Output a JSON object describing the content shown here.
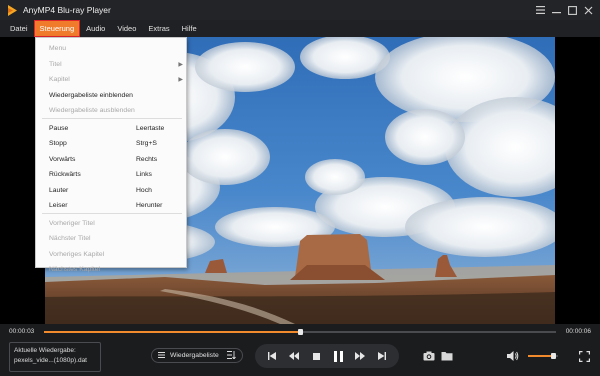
{
  "app": {
    "title": "AnyMP4 Blu-ray Player"
  },
  "colors": {
    "accent": "#f08a2c",
    "menu_highlight": "#f07c2b",
    "highlight_border": "#e0232b",
    "bar_bg": "#1b1c1e"
  },
  "menubar": {
    "items": [
      {
        "label": "Datei",
        "active": false
      },
      {
        "label": "Steuerung",
        "active": true
      },
      {
        "label": "Audio",
        "active": false
      },
      {
        "label": "Video",
        "active": false
      },
      {
        "label": "Extras",
        "active": false
      },
      {
        "label": "Hilfe",
        "active": false
      }
    ]
  },
  "dropdown": {
    "items": [
      {
        "label": "Menu",
        "shortcut": "",
        "disabled": true,
        "submenu": false
      },
      {
        "label": "Titel",
        "shortcut": "",
        "disabled": true,
        "submenu": true
      },
      {
        "label": "Kapitel",
        "shortcut": "",
        "disabled": true,
        "submenu": true
      },
      {
        "label": "Wiedergabeliste einblenden",
        "shortcut": "",
        "disabled": false,
        "submenu": false
      },
      {
        "label": "Wiedergabeliste ausblenden",
        "shortcut": "",
        "disabled": true,
        "submenu": false
      },
      {
        "label": "Pause",
        "shortcut": "Leertaste",
        "disabled": false,
        "submenu": false
      },
      {
        "label": "Stopp",
        "shortcut": "Strg+S",
        "disabled": false,
        "submenu": false
      },
      {
        "label": "Vorwärts",
        "shortcut": "Rechts",
        "disabled": false,
        "submenu": false
      },
      {
        "label": "Rückwärts",
        "shortcut": "Links",
        "disabled": false,
        "submenu": false
      },
      {
        "label": "Lauter",
        "shortcut": "Hoch",
        "disabled": false,
        "submenu": false
      },
      {
        "label": "Leiser",
        "shortcut": "Herunter",
        "disabled": false,
        "submenu": false
      },
      {
        "label": "Vorheriger Titel",
        "shortcut": "",
        "disabled": true,
        "submenu": false
      },
      {
        "label": "Nächster Titel",
        "shortcut": "",
        "disabled": true,
        "submenu": false
      },
      {
        "label": "Vorheriges Kapitel",
        "shortcut": "",
        "disabled": true,
        "submenu": false
      },
      {
        "label": "Nächstes Kapitel",
        "shortcut": "",
        "disabled": true,
        "submenu": false
      }
    ]
  },
  "playback": {
    "current_time": "00:00:03",
    "total_time": "00:00:06",
    "progress": 0.5,
    "volume": 0.85
  },
  "now_playing": {
    "label": "Aktuelle Wiedergabe:",
    "filename": "pexels_vide...(1080p).dat"
  },
  "controls": {
    "playlist_label": "Wiedergabeliste",
    "icons": [
      "prev-track-icon",
      "rewind-icon",
      "stop-icon",
      "pause-icon",
      "fast-forward-icon",
      "next-track-icon",
      "snapshot-icon",
      "folder-icon",
      "volume-icon",
      "fullscreen-icon"
    ]
  }
}
